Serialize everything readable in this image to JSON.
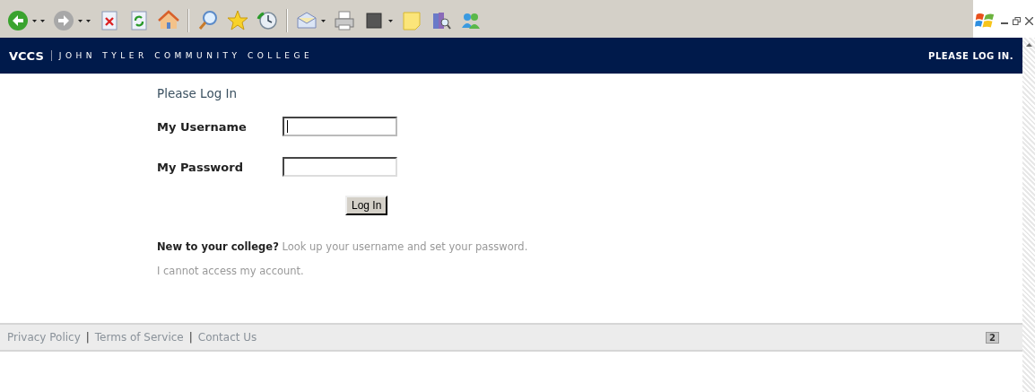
{
  "header": {
    "brand": "VCCS",
    "college": "JOHN TYLER COMMUNITY COLLEGE",
    "status": "PLEASE LOG IN."
  },
  "form": {
    "title": "Please Log In",
    "fields": [
      {
        "label": "My Username",
        "focused": true
      },
      {
        "label": "My Password",
        "focused": false
      }
    ],
    "button": "Log In"
  },
  "help": [
    {
      "kind": "lead",
      "lead": "**New to your college?**",
      "link": "Look up your username and set your password",
      "after": "."
    },
    {
      "kind": "plain",
      "link": "I cannot access my account",
      "after": "."
    }
  ],
  "footer": {
    "items": [
      {
        "kind": "link",
        "text": "Privacy Policy"
      },
      {
        "kind": "separator",
        "text": "|"
      },
      {
        "kind": "link",
        "text": "Terms of Service"
      },
      {
        "kind": "separator",
        "text": "|"
      },
      {
        "kind": "link",
        "text": "Contact Us"
      }
    ],
    "badge": "2"
  }
}
